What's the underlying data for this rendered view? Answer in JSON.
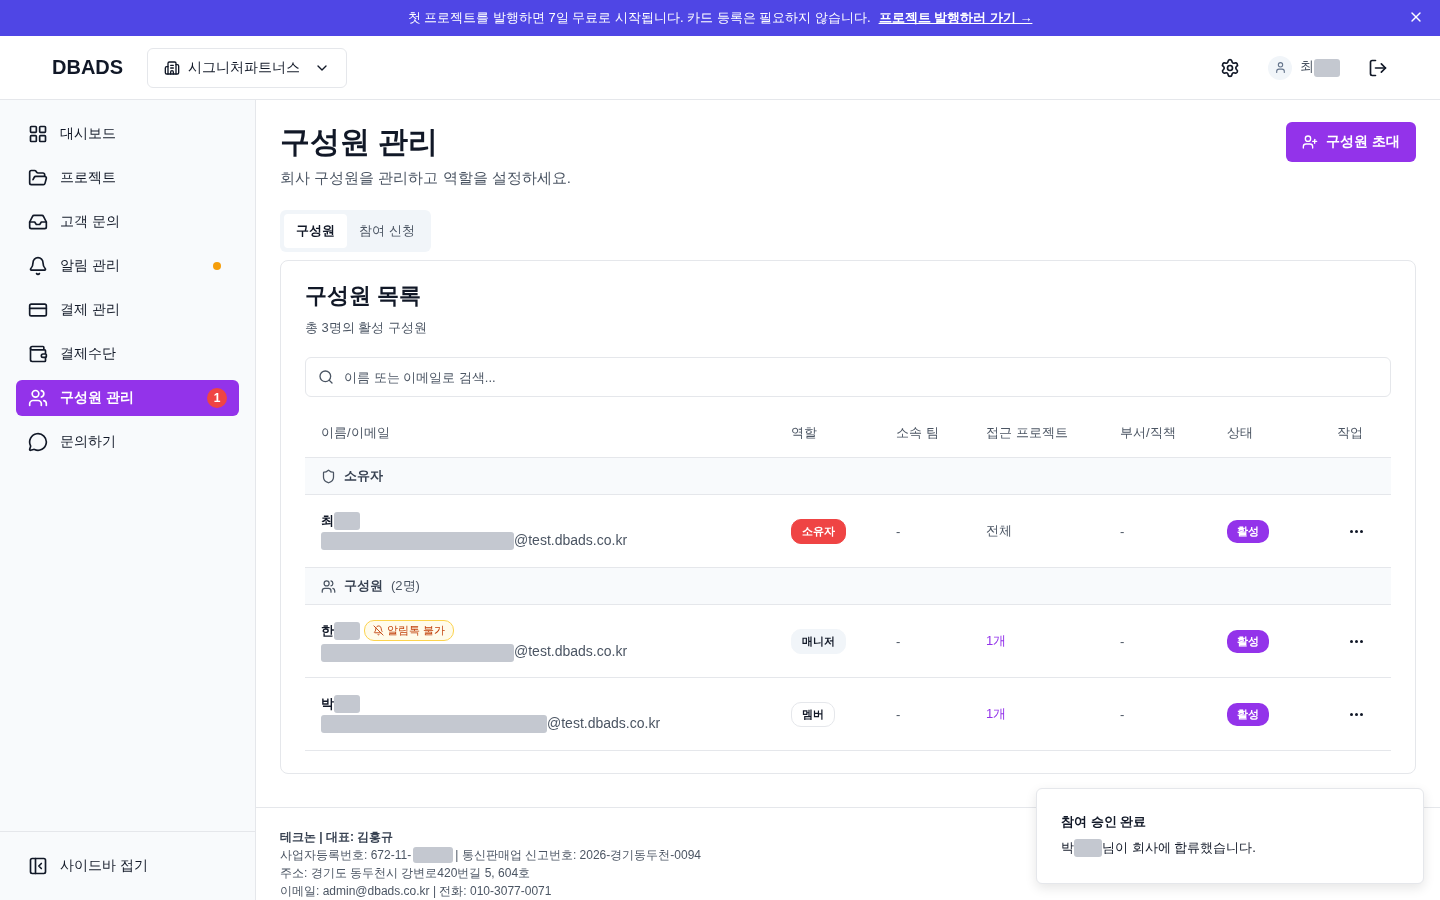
{
  "banner": {
    "text": "첫 프로젝트를 발행하면 7일 무료로 시작됩니다. 카드 등록은 필요하지 않습니다.",
    "link": "프로젝트 발행하러 가기 →"
  },
  "header": {
    "logo": "DBADS",
    "company": "시그니처파트너스",
    "user_initial": "최"
  },
  "sidebar": {
    "items": [
      {
        "kind": "grid",
        "label": "대시보드",
        "selected": false
      },
      {
        "kind": "folder",
        "label": "프로젝트",
        "selected": false
      },
      {
        "kind": "inbox",
        "label": "고객 문의",
        "selected": false
      },
      {
        "kind": "bell",
        "label": "알림 관리",
        "selected": false,
        "color": "#f59e0b"
      },
      {
        "kind": "card",
        "label": "결제 관리",
        "selected": false
      },
      {
        "kind": "wallet",
        "label": "결제수단",
        "selected": false
      },
      {
        "kind": "users",
        "label": "구성원 관리",
        "selected": true,
        "badge": "1"
      },
      {
        "kind": "chat",
        "label": "문의하기",
        "selected": false
      }
    ],
    "collapse": "사이드바 접기"
  },
  "page": {
    "title": "구성원 관리",
    "subtitle": "회사 구성원을 관리하고 역할을 설정하세요.",
    "invite_button": "구성원 초대"
  },
  "tabs": [
    {
      "label": "구성원",
      "selected": true
    },
    {
      "label": "참여 신청",
      "selected": false
    }
  ],
  "card": {
    "title": "구성원 목록",
    "subtitle": "총 3명의 활성 구성원",
    "search": {
      "placeholder": "이름 또는 이메일로 검색..."
    }
  },
  "table": {
    "columns": [
      "이름/이메일",
      "역할",
      "소속 팀",
      "접근 프로젝트",
      "부서/직책",
      "상태",
      "작업"
    ],
    "groups": [
      {
        "kind": "shield",
        "label": "소유자",
        "rows": [
          {
            "name": "최",
            "email": "@test.dbads.co.kr",
            "role": "소유자",
            "kind": "owner",
            "team": "-",
            "projects": "전체",
            "projects_link": false,
            "dept": "-",
            "status": "활성"
          }
        ]
      },
      {
        "kind": "users",
        "label": "구성원",
        "count": "(2명)",
        "rows": [
          {
            "name": "한",
            "warning": "알림톡 불가",
            "email": "@test.dbads.co.kr",
            "role": "매니저",
            "kind": "manager",
            "team": "-",
            "projects": "1개",
            "projects_link": true,
            "dept": "-",
            "status": "활성"
          },
          {
            "name": "박",
            "email": "@test.dbads.co.kr",
            "role": "멤버",
            "kind": "member",
            "team": "-",
            "projects": "1개",
            "projects_link": true,
            "dept": "-",
            "status": "활성"
          }
        ]
      }
    ]
  },
  "footer": {
    "company": "테크논 | 대표: 김홍규",
    "lines": [
      "사업자등록번호: 672-11-",
      "| 통신판매업 신고번호: 2026-경기동두천-0094"
    ],
    "address": "주소: 경기도 동두천시 강변로420번길 5, 604호",
    "contact": "이메일: admin@dbads.co.kr | 전화: 010-3077-0071"
  },
  "toast": {
    "title": "참여 승인 완료",
    "name": "박",
    "message": "님이 회사에 합류했습니다."
  }
}
